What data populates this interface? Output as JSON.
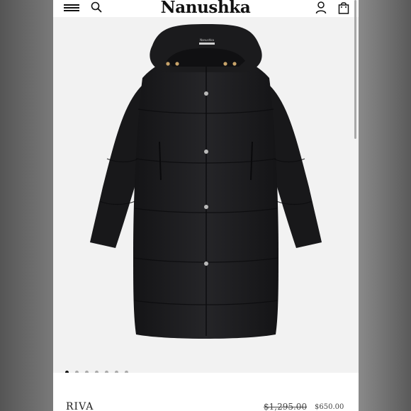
{
  "header": {
    "logo_text": "Nanushka",
    "icons": [
      "menu-icon",
      "search-icon",
      "account-icon",
      "shopping-bag-icon"
    ]
  },
  "product": {
    "image": {
      "subject": "coat",
      "label_text": "Nanushka"
    },
    "carousel": {
      "total_slides": 7,
      "active_index": 0
    },
    "name": "RIVA",
    "original_price": "$1,295.00",
    "sale_price": "$650.00"
  },
  "colors": {
    "background": "#f2f2f2",
    "text": "#111111",
    "coat": "#1c1c1e",
    "dot_active": "#111111",
    "dot_inactive": "#a9a9a9"
  }
}
